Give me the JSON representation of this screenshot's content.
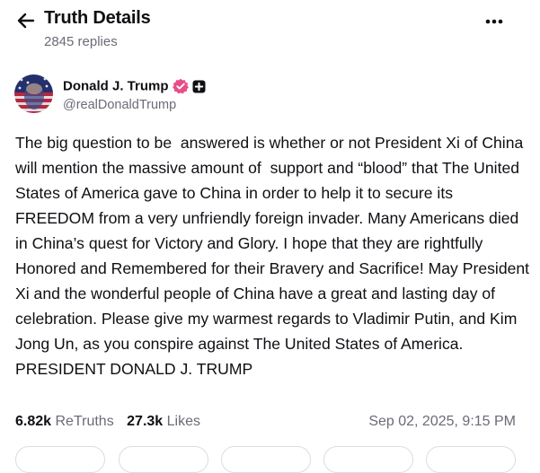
{
  "header": {
    "title": "Truth Details",
    "replies": "2845 replies",
    "back_icon": "arrow-left-icon",
    "more_icon": "more-horizontal-icon"
  },
  "author": {
    "display_name": "Donald J. Trump",
    "handle": "@realDonaldTrump",
    "verified_color": "#e84d8a",
    "badge_icon": "plus-badge-icon"
  },
  "post": {
    "text": "The big question to be  answered is whether or not President Xi of China will mention the massive amount of  support and “blood” that The United States of America gave to China in order to help it to secure its FREEDOM from a very unfriendly foreign invader. Many Americans died in China’s quest for Victory and Glory. I hope that they are rightfully Honored and Remembered for their Bravery and Sacrifice! May President Xi and the wonderful people of China have a great and lasting day of celebration. Please give my warmest regards to Vladimir Putin, and Kim Jong Un, as you conspire against The United States of America. PRESIDENT DONALD J. TRUMP"
  },
  "stats": {
    "retruths_count": "6.82k",
    "retruths_label": "ReTruths",
    "likes_count": "27.3k",
    "likes_label": "Likes",
    "timestamp": "Sep 02, 2025, 9:15 PM"
  },
  "colors": {
    "text": "#0f0f14",
    "muted": "#6b6b78",
    "accent": "#e84d8a"
  }
}
